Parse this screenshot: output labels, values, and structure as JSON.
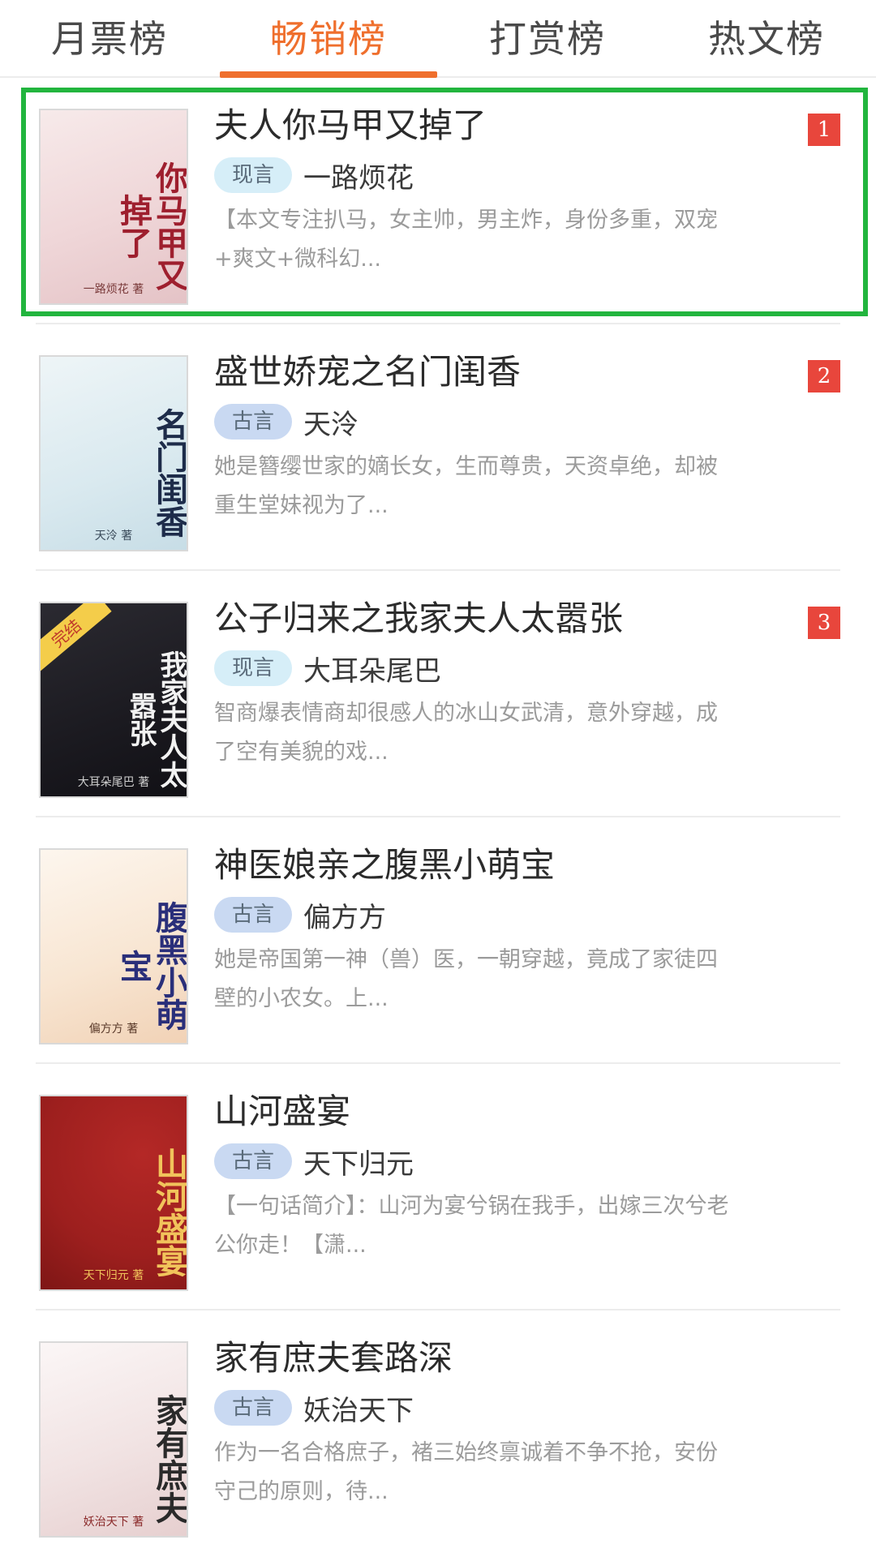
{
  "tabs": [
    {
      "label": "月票榜",
      "active": false
    },
    {
      "label": "畅销榜",
      "active": true
    },
    {
      "label": "打赏榜",
      "active": false
    },
    {
      "label": "热文榜",
      "active": false
    }
  ],
  "books": [
    {
      "title": "夫人你马甲又掉了",
      "genre": "现言",
      "author": "一路烦花",
      "desc": "【本文专注扒马，女主帅，男主炸，身份多重，双宠+爽文+微科幻...",
      "rank": "1",
      "cover": {
        "title": "你马甲又掉了",
        "bg": "#f3e3e3",
        "fg": "#9e1f2e",
        "author": "一路烦花 著"
      }
    },
    {
      "title": "盛世娇宠之名门闺香",
      "genre": "古言",
      "author": "天泠",
      "desc": "她是簪缨世家的嫡长女，生而尊贵，天资卓绝，却被重生堂妹视为了...",
      "rank": "2",
      "cover": {
        "title": "名门闺香",
        "bg": "#e2eef3",
        "fg": "#1e2c4a",
        "author": "天泠 著"
      }
    },
    {
      "title": "公子归来之我家夫人太嚣张",
      "genre": "现言",
      "author": "大耳朵尾巴",
      "desc": "智商爆表情商却很感人的冰山女武清，意外穿越，成了空有美貌的戏...",
      "rank": "3",
      "cover": {
        "title": "我家夫人太嚣张",
        "bg": "#1d1c22",
        "fg": "#f2f2f2",
        "author": "大耳朵尾巴 著",
        "badge": "完结"
      }
    },
    {
      "title": "神医娘亲之腹黑小萌宝",
      "genre": "古言",
      "author": "偏方方",
      "desc": "她是帝国第一神（兽）医，一朝穿越，竟成了家徒四壁的小农女。上...",
      "rank": "",
      "cover": {
        "title": "腹黑小萌宝",
        "bg": "#fbefe2",
        "fg": "#2a2f7a",
        "author": "偏方方 著"
      }
    },
    {
      "title": "山河盛宴",
      "genre": "古言",
      "author": "天下归元",
      "desc": "【一句话简介】：山河为宴兮锅在我手，出嫁三次兮老公你走！【潇...",
      "rank": "",
      "cover": {
        "title": "山河盛宴",
        "bg": "#a82220",
        "fg": "#f1c35b",
        "author": "天下归元 著"
      }
    },
    {
      "title": "家有庶夫套路深",
      "genre": "古言",
      "author": "妖治天下",
      "desc": "作为一名合格庶子，褚三始终禀诚着不争不抢，安份守己的原则，待...",
      "rank": "",
      "cover": {
        "title": "家有庶夫",
        "bg": "#f6eeee",
        "fg": "#2a2a2a",
        "author": "妖治天下 著"
      }
    }
  ],
  "colors": {
    "accent": "#ef6f2d",
    "rank": "#e8463c",
    "highlight_border": "#22b53e"
  }
}
